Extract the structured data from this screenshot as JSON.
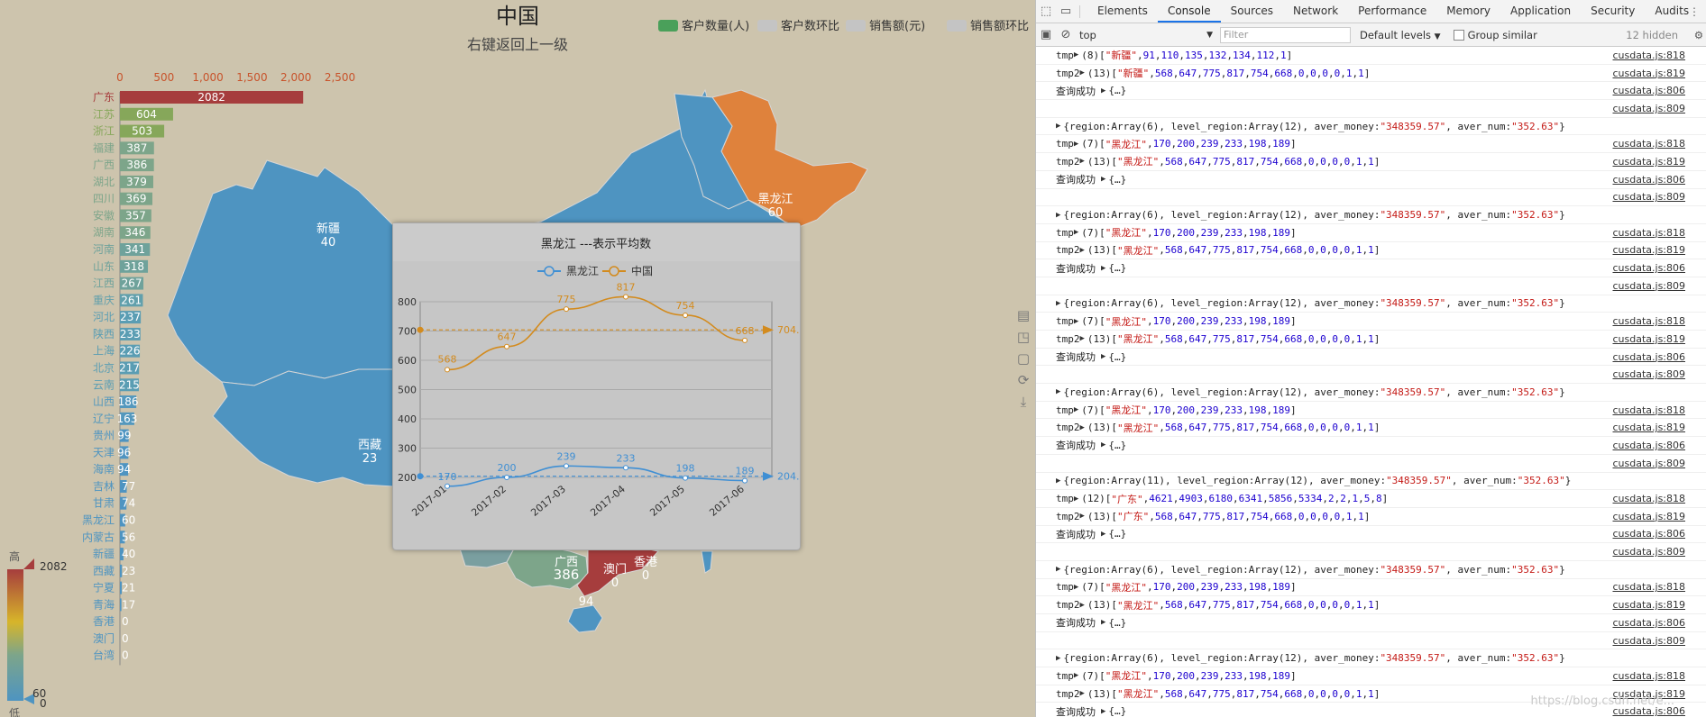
{
  "page": {
    "title": "中国",
    "subtitle": "右键返回上一级"
  },
  "legend": [
    {
      "label": "客户数量(人)",
      "color": "#4aa05a",
      "active": true
    },
    {
      "label": "客户数环比",
      "color": "#c4c4c4",
      "active": false
    },
    {
      "label": "销售额(元)",
      "color": "#c4c4c4",
      "active": false
    },
    {
      "label": "销售额环比",
      "color": "#c4c4c4",
      "active": false
    }
  ],
  "colors": {
    "background": "#cdc4ad",
    "map_base": "#4e94c1",
    "highlight": "#df823c",
    "guangdong": "#a63d3d",
    "guangxi": "#7da58a",
    "line_heilongjiang": "#3f8fd4",
    "line_china": "#d38b1e"
  },
  "map": {
    "labels": [
      {
        "id": "xinjiang",
        "name": "新疆",
        "value": "40"
      },
      {
        "id": "xizang",
        "name": "西藏",
        "value": "23"
      },
      {
        "id": "heilongjiang",
        "name": "黑龙江",
        "value": "60"
      },
      {
        "id": "guangxi",
        "name": "广西",
        "value": "386"
      },
      {
        "id": "guangdong",
        "name": "",
        "value": "2082"
      },
      {
        "id": "aomen",
        "name": "澳门",
        "value": "0"
      },
      {
        "id": "xianggang",
        "name": "香港",
        "value": "0"
      },
      {
        "id": "hainan",
        "name": "",
        "value": "94"
      }
    ]
  },
  "chart_data": [
    {
      "type": "bar",
      "orientation": "horizontal",
      "title": "",
      "xlim": [
        0,
        2500
      ],
      "xticks": [
        "0",
        "500",
        "1,000",
        "1,500",
        "2,000",
        "2,500"
      ],
      "categories": [
        "广东",
        "江苏",
        "浙江",
        "福建",
        "广西",
        "湖北",
        "四川",
        "安徽",
        "湖南",
        "河南",
        "山东",
        "江西",
        "重庆",
        "河北",
        "陕西",
        "上海",
        "北京",
        "云南",
        "山西",
        "辽宁",
        "贵州",
        "天津",
        "海南",
        "吉林",
        "甘肃",
        "黑龙江",
        "内蒙古",
        "新疆",
        "西藏",
        "宁夏",
        "青海",
        "香港",
        "澳门",
        "台湾"
      ],
      "values": [
        2082,
        604,
        503,
        387,
        386,
        379,
        369,
        357,
        346,
        341,
        318,
        267,
        261,
        237,
        233,
        226,
        217,
        215,
        186,
        163,
        99,
        96,
        94,
        77,
        74,
        60,
        56,
        40,
        23,
        21,
        17,
        0,
        0,
        0
      ],
      "colors": [
        "#a63d3d",
        "#86a75a",
        "#86a75a",
        "#7da58a",
        "#7da58a",
        "#7da58a",
        "#7da58a",
        "#7da58a",
        "#7da58a",
        "#6fa29b",
        "#6fa29b",
        "#6fa29b",
        "#62a0ac",
        "#5a9db3",
        "#5a9db3",
        "#5a9db3",
        "#5a9db3",
        "#5a9db3",
        "#5498bd",
        "#5498bd",
        "#4e94c1",
        "#4e94c1",
        "#4e94c1",
        "#4e94c1",
        "#4e94c1",
        "#4e94c1",
        "#4e94c1",
        "#4e94c1",
        "#4e94c1",
        "#4e94c1",
        "#4e94c1",
        "#4e94c1",
        "#4e94c1",
        "#4e94c1"
      ]
    },
    {
      "type": "line",
      "title": "黑龙江 ---表示平均数",
      "categories": [
        "2017-01",
        "2017-02",
        "2017-03",
        "2017-04",
        "2017-05",
        "2017-06"
      ],
      "ylim": [
        200,
        800
      ],
      "yticks": [
        "200",
        "300",
        "400",
        "500",
        "600",
        "700",
        "800"
      ],
      "series": [
        {
          "name": "黑龙江",
          "values": [
            170,
            200,
            239,
            233,
            198,
            189
          ],
          "mean": 204,
          "mean_label": "204.",
          "color": "#3f8fd4"
        },
        {
          "name": "中国",
          "values": [
            568,
            647,
            775,
            817,
            754,
            668
          ],
          "mean": 704,
          "mean_label": "704.",
          "color": "#d38b1e"
        }
      ]
    }
  ],
  "visual_map": {
    "high_label": "高",
    "low_label": "低",
    "max": "2082",
    "min": "0",
    "handle_value": "60"
  },
  "toolbox": [
    {
      "icon": "data-view-icon"
    },
    {
      "icon": "magic-type-icon"
    },
    {
      "icon": "restore-icon"
    },
    {
      "icon": "refresh-icon"
    },
    {
      "icon": "save-image-icon"
    }
  ],
  "devtools": {
    "tabs": [
      "Elements",
      "Console",
      "Sources",
      "Network",
      "Performance",
      "Memory",
      "Application",
      "Security",
      "Audits"
    ],
    "active_tab": "Console",
    "context": "top",
    "filter_placeholder": "Filter",
    "levels": "Default levels",
    "group_similar": "Group similar",
    "hidden": "12 hidden",
    "watermark": "https://blog.csdn.net/e..."
  },
  "console": [
    {
      "kind": "arr",
      "label": "tmp",
      "count": "(8)",
      "values": [
        "\"新疆\"",
        "91",
        "110",
        "135",
        "132",
        "134",
        "112",
        "1"
      ],
      "src": "cusdata.js:818"
    },
    {
      "kind": "arr",
      "label": "tmp2",
      "count": "(13)",
      "values": [
        "\"新疆\"",
        "568",
        "647",
        "775",
        "817",
        "754",
        "668",
        "0",
        "0",
        "0",
        "0",
        "1",
        "1"
      ],
      "src": "cusdata.js:819"
    },
    {
      "kind": "msg",
      "text": "查询成功",
      "obj": "{…}",
      "src": "cusdata.js:806"
    },
    {
      "kind": "blank",
      "src": "cusdata.js:809"
    },
    {
      "kind": "obj",
      "region": "Array(6)",
      "level": "Array(12)",
      "money": "\"348359.57\"",
      "num": "\"352.63\"",
      "src": ""
    },
    {
      "kind": "arr",
      "label": "tmp",
      "count": "(7)",
      "values": [
        "\"黑龙江\"",
        "170",
        "200",
        "239",
        "233",
        "198",
        "189"
      ],
      "src": "cusdata.js:818"
    },
    {
      "kind": "arr",
      "label": "tmp2",
      "count": "(13)",
      "values": [
        "\"黑龙江\"",
        "568",
        "647",
        "775",
        "817",
        "754",
        "668",
        "0",
        "0",
        "0",
        "0",
        "1",
        "1"
      ],
      "src": "cusdata.js:819"
    },
    {
      "kind": "msg",
      "text": "查询成功",
      "obj": "{…}",
      "src": "cusdata.js:806"
    },
    {
      "kind": "blank",
      "src": "cusdata.js:809"
    },
    {
      "kind": "obj",
      "region": "Array(6)",
      "level": "Array(12)",
      "money": "\"348359.57\"",
      "num": "\"352.63\"",
      "src": ""
    },
    {
      "kind": "arr",
      "label": "tmp",
      "count": "(7)",
      "values": [
        "\"黑龙江\"",
        "170",
        "200",
        "239",
        "233",
        "198",
        "189"
      ],
      "src": "cusdata.js:818"
    },
    {
      "kind": "arr",
      "label": "tmp2",
      "count": "(13)",
      "values": [
        "\"黑龙江\"",
        "568",
        "647",
        "775",
        "817",
        "754",
        "668",
        "0",
        "0",
        "0",
        "0",
        "1",
        "1"
      ],
      "src": "cusdata.js:819"
    },
    {
      "kind": "msg",
      "text": "查询成功",
      "obj": "{…}",
      "src": "cusdata.js:806"
    },
    {
      "kind": "blank",
      "src": "cusdata.js:809"
    },
    {
      "kind": "obj",
      "region": "Array(6)",
      "level": "Array(12)",
      "money": "\"348359.57\"",
      "num": "\"352.63\"",
      "src": ""
    },
    {
      "kind": "arr",
      "label": "tmp",
      "count": "(7)",
      "values": [
        "\"黑龙江\"",
        "170",
        "200",
        "239",
        "233",
        "198",
        "189"
      ],
      "src": "cusdata.js:818"
    },
    {
      "kind": "arr",
      "label": "tmp2",
      "count": "(13)",
      "values": [
        "\"黑龙江\"",
        "568",
        "647",
        "775",
        "817",
        "754",
        "668",
        "0",
        "0",
        "0",
        "0",
        "1",
        "1"
      ],
      "src": "cusdata.js:819"
    },
    {
      "kind": "msg",
      "text": "查询成功",
      "obj": "{…}",
      "src": "cusdata.js:806"
    },
    {
      "kind": "blank",
      "src": "cusdata.js:809"
    },
    {
      "kind": "obj",
      "region": "Array(6)",
      "level": "Array(12)",
      "money": "\"348359.57\"",
      "num": "\"352.63\"",
      "src": ""
    },
    {
      "kind": "arr",
      "label": "tmp",
      "count": "(7)",
      "values": [
        "\"黑龙江\"",
        "170",
        "200",
        "239",
        "233",
        "198",
        "189"
      ],
      "src": "cusdata.js:818"
    },
    {
      "kind": "arr",
      "label": "tmp2",
      "count": "(13)",
      "values": [
        "\"黑龙江\"",
        "568",
        "647",
        "775",
        "817",
        "754",
        "668",
        "0",
        "0",
        "0",
        "0",
        "1",
        "1"
      ],
      "src": "cusdata.js:819"
    },
    {
      "kind": "msg",
      "text": "查询成功",
      "obj": "{…}",
      "src": "cusdata.js:806"
    },
    {
      "kind": "blank",
      "src": "cusdata.js:809"
    },
    {
      "kind": "obj",
      "region": "Array(11)",
      "level": "Array(12)",
      "money": "\"348359.57\"",
      "num": "\"352.63\"",
      "src": ""
    },
    {
      "kind": "arr",
      "label": "tmp",
      "count": "(12)",
      "values": [
        "\"广东\"",
        "4621",
        "4903",
        "6180",
        "6341",
        "5856",
        "5334",
        "2",
        "2",
        "1",
        "5",
        "8"
      ],
      "src": "cusdata.js:818"
    },
    {
      "kind": "arr",
      "label": "tmp2",
      "count": "(13)",
      "values": [
        "\"广东\"",
        "568",
        "647",
        "775",
        "817",
        "754",
        "668",
        "0",
        "0",
        "0",
        "0",
        "1",
        "1"
      ],
      "src": "cusdata.js:819"
    },
    {
      "kind": "msg",
      "text": "查询成功",
      "obj": "{…}",
      "src": "cusdata.js:806"
    },
    {
      "kind": "blank",
      "src": "cusdata.js:809"
    },
    {
      "kind": "obj",
      "region": "Array(6)",
      "level": "Array(12)",
      "money": "\"348359.57\"",
      "num": "\"352.63\"",
      "src": ""
    },
    {
      "kind": "arr",
      "label": "tmp",
      "count": "(7)",
      "values": [
        "\"黑龙江\"",
        "170",
        "200",
        "239",
        "233",
        "198",
        "189"
      ],
      "src": "cusdata.js:818"
    },
    {
      "kind": "arr",
      "label": "tmp2",
      "count": "(13)",
      "values": [
        "\"黑龙江\"",
        "568",
        "647",
        "775",
        "817",
        "754",
        "668",
        "0",
        "0",
        "0",
        "0",
        "1",
        "1"
      ],
      "src": "cusdata.js:819"
    },
    {
      "kind": "msg",
      "text": "查询成功",
      "obj": "{…}",
      "src": "cusdata.js:806"
    },
    {
      "kind": "blank",
      "src": "cusdata.js:809"
    },
    {
      "kind": "obj",
      "region": "Array(6)",
      "level": "Array(12)",
      "money": "\"348359.57\"",
      "num": "\"352.63\"",
      "src": ""
    },
    {
      "kind": "arr",
      "label": "tmp",
      "count": "(7)",
      "values": [
        "\"黑龙江\"",
        "170",
        "200",
        "239",
        "233",
        "198",
        "189"
      ],
      "src": "cusdata.js:818"
    },
    {
      "kind": "arr",
      "label": "tmp2",
      "count": "(13)",
      "values": [
        "\"黑龙江\"",
        "568",
        "647",
        "775",
        "817",
        "754",
        "668",
        "0",
        "0",
        "0",
        "0",
        "1",
        "1"
      ],
      "src": "cusdata.js:819"
    },
    {
      "kind": "msg",
      "text": "查询成功",
      "obj": "{…}",
      "src": "cusdata.js:806"
    }
  ]
}
